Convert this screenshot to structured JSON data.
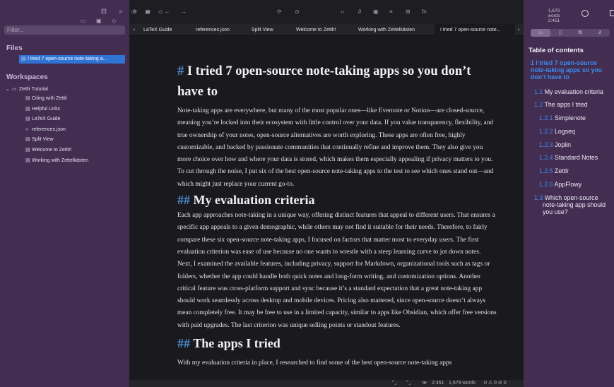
{
  "left_sidebar": {
    "filter_placeholder": "Filter...",
    "files_heading": "Files",
    "active_file": "I tried 7 open-source note-taking a...",
    "workspaces_heading": "Workspaces",
    "workspace_root": "Zettlr Tutorial",
    "workspace_items": [
      {
        "label": "Citing with Zettlr",
        "icon": "file-icon"
      },
      {
        "label": "Helpful Links",
        "icon": "file-icon"
      },
      {
        "label": "LaTeX Guide",
        "icon": "file-icon"
      },
      {
        "label": "references.json",
        "icon": "code-icon"
      },
      {
        "label": "Split View",
        "icon": "file-icon"
      },
      {
        "label": "Welcome to Zettlr!",
        "icon": "file-icon"
      },
      {
        "label": "Working with Zettelkästen",
        "icon": "file-icon"
      }
    ]
  },
  "tabs": [
    {
      "label": "LaTeX Guide",
      "active": false
    },
    {
      "label": "references.json",
      "active": false
    },
    {
      "label": "Split View",
      "active": false
    },
    {
      "label": "Welcome to Zettlr!",
      "active": false
    },
    {
      "label": "Working with Zettelkästen",
      "active": false
    },
    {
      "label": "I tried 7 open-source note...",
      "active": true
    }
  ],
  "document": {
    "title_hash": "#",
    "title": "I tried 7 open-source note-taking apps so you don’t have to",
    "intro": "Note-taking apps are everywhere, but many of the most popular ones—like Evernote or Notion—are closed-source, meaning you’re locked into their ecosystem with little control over your data. If you value transparency, flexibility, and true ownership of your notes, open-source alternatives are worth exploring. These apps are often free, highly customizable, and backed by passionate communities that continually refine and improve them. They also give you more choice over how and where your data is stored, which makes them especially appealing if privacy matters to you. To cut through the noise, I put six of the best open-source note-taking apps to the test to see which ones stand out—and which might just replace your current go-to.",
    "h2_hash": "##",
    "section1_title": "My evaluation criteria",
    "section1_p1": "Each app approaches note-taking in a unique way, offering distinct features that appeal to different users. That ensures a specific app appeals to a given demographic, while others may not find it suitable for their needs. Therefore, to fairly compare these six open-source note-taking apps, I focused on factors that matter most to everyday users. The first evaluation criterion was ease of use because no one wants to wrestle with a steep learning curve to jot down notes.",
    "section1_p2": "Next, I examined the available features, including privacy, support for Markdown, organizational tools such as tags or folders, whether the app could handle both quick notes and long-form writing, and customization options. Another critical feature was cross-platform support and sync because it’s a standard expectation that a great note-taking app should work seamlessly across desktop and mobile devices. Pricing also mattered, since open-source doesn’t always mean completely free. It may be free to use in a limited capacity, similar to apps like Obsidian, which offer free versions with paid upgrades. The last criterion was unique selling points or standout features.",
    "section2_title": "The apps I tried",
    "section2_p1": "With my evaluation criteria in place, I researched to find some of the best open-source note-taking apps"
  },
  "status_bar": {
    "position": "2:451",
    "words": "1,679 words",
    "diagnostics": "0 ⚠ 0 ⊘ 0"
  },
  "right_sidebar": {
    "word_count": "1,679 words",
    "char_position": "2:451",
    "toc_title": "Table of contents",
    "toc": [
      {
        "num": "1",
        "text": "I tried 7 open-source note-taking apps so you don’t have to",
        "level": 1
      },
      {
        "num": "1.1",
        "text": "My evaluation criteria",
        "level": 2
      },
      {
        "num": "1.2",
        "text": "The apps I tried",
        "level": 2
      },
      {
        "num": "1.2.1",
        "text": "Simplenote",
        "level": 3
      },
      {
        "num": "1.2.2",
        "text": "Logseq",
        "level": 3
      },
      {
        "num": "1.2.3",
        "text": "Joplin",
        "level": 3
      },
      {
        "num": "1.2.4",
        "text": "Standard Notes",
        "level": 3
      },
      {
        "num": "1.2.5",
        "text": "Zettlr",
        "level": 3
      },
      {
        "num": "1.2.6",
        "text": "AppFlowy",
        "level": 3
      },
      {
        "num": "1.3",
        "text": "Which open-source note-taking app should you use?",
        "level": 2
      }
    ]
  },
  "colors": {
    "sidebar_bg": "#432e52",
    "editor_bg": "#1a1a1e",
    "accent": "#3d8bef",
    "active_file_bg": "#2f73d4"
  }
}
